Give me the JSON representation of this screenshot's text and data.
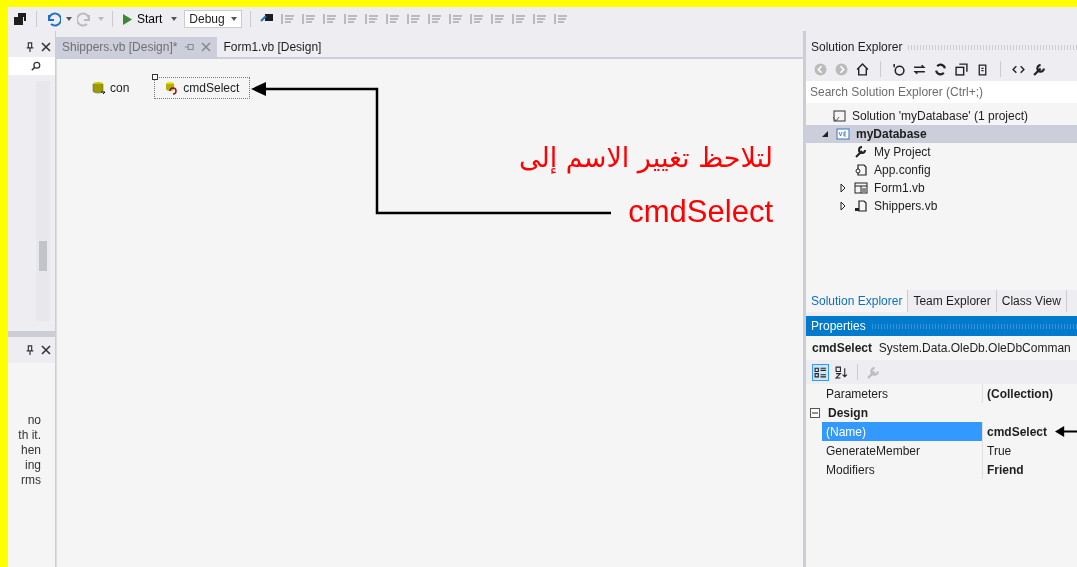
{
  "toolbar": {
    "start_button": "Start",
    "configuration": "Debug"
  },
  "left_panel": {
    "text_fragments": [
      "no",
      "th it.",
      "hen",
      "ing",
      "rms"
    ]
  },
  "document_tabs": [
    {
      "label": "Shippers.vb [Design]*",
      "selected": false
    },
    {
      "label": "Form1.vb [Design]",
      "selected": true
    }
  ],
  "component_tray": [
    {
      "name": "con",
      "kind": "connection",
      "selected": false
    },
    {
      "name": "cmdSelect",
      "kind": "command",
      "selected": true
    }
  ],
  "annotation": {
    "text": "لتلاحظ تغيير الاسم إلى",
    "target": "cmdSelect"
  },
  "solution_explorer": {
    "title": "Solution Explorer",
    "search_placeholder": "Search Solution Explorer (Ctrl+;)",
    "tree": [
      {
        "label": "Solution 'myDatabase' (1 project)",
        "kind": "solution",
        "selected": false,
        "children": [
          {
            "label": "myDatabase",
            "kind": "project",
            "selected": true,
            "expanded": true,
            "children": [
              {
                "label": "My Project",
                "kind": "properties",
                "selected": false
              },
              {
                "label": "App.config",
                "kind": "config",
                "selected": false
              },
              {
                "label": "Form1.vb",
                "kind": "form",
                "selected": false,
                "expanded": false
              },
              {
                "label": "Shippers.vb",
                "kind": "module",
                "selected": false,
                "expanded": false
              }
            ]
          }
        ]
      }
    ]
  },
  "bottom_tabs": [
    {
      "label": "Solution Explorer",
      "selected": true
    },
    {
      "label": "Team Explorer",
      "selected": false
    },
    {
      "label": "Class View",
      "selected": false
    }
  ],
  "properties": {
    "title": "Properties",
    "object_name": "cmdSelect",
    "object_type": "System.Data.OleDb.OleDbComman",
    "rows": [
      {
        "kind": "property",
        "name": "Parameters",
        "value": "(Collection)",
        "bold": true,
        "selected": false
      },
      {
        "kind": "category",
        "name": "Design",
        "expanded": true
      },
      {
        "kind": "property",
        "name": "(Name)",
        "value": "cmdSelect",
        "bold": true,
        "selected": true
      },
      {
        "kind": "property",
        "name": "GenerateMember",
        "value": "True",
        "bold": false,
        "selected": false
      },
      {
        "kind": "property",
        "name": "Modifiers",
        "value": "Friend",
        "bold": true,
        "selected": false
      }
    ]
  }
}
